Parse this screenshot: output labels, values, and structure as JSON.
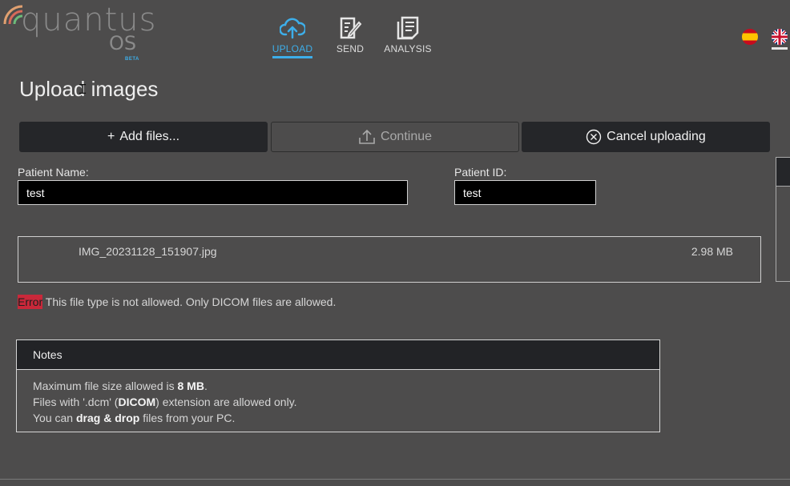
{
  "brand": {
    "name": "quantus",
    "suffix": "OS",
    "tag": "BETA",
    "accent": "#3daee9"
  },
  "nav": {
    "items": [
      {
        "label": "UPLOAD",
        "icon": "cloud-upload-icon",
        "active": true
      },
      {
        "label": "SEND",
        "icon": "edit-document-icon",
        "active": false
      },
      {
        "label": "ANALYSIS",
        "icon": "document-list-icon",
        "active": false
      }
    ]
  },
  "languages": [
    {
      "code": "es",
      "icon": "spain-flag-icon"
    },
    {
      "code": "en",
      "icon": "uk-flag-icon",
      "selected": true
    }
  ],
  "page": {
    "title": "Upload images"
  },
  "actions": {
    "add_label": "Add files...",
    "continue_label": "Continue",
    "cancel_label": "Cancel uploading"
  },
  "form": {
    "patient_name_label": "Patient Name:",
    "patient_name_value": "test",
    "patient_id_label": "Patient ID:",
    "patient_id_value": "test"
  },
  "file": {
    "name": "IMG_20231128_151907.jpg",
    "size": "2.98 MB"
  },
  "error": {
    "badge": "Error",
    "message": "This file type is not allowed. Only DICOM files are allowed."
  },
  "notes": {
    "title": "Notes",
    "line1_pre": "Maximum file size allowed is ",
    "line1_bold": "8 MB",
    "line1_post": ".",
    "line2_pre": "Files with '.dcm' (",
    "line2_bold": "DICOM",
    "line2_post": ") extension are allowed only.",
    "line3_pre": "You can ",
    "line3_bold": "drag & drop",
    "line3_post": " files from your PC."
  },
  "colors": {
    "background": "#4d4c4c",
    "button_dark": "#252629",
    "error": "#c9283a"
  }
}
